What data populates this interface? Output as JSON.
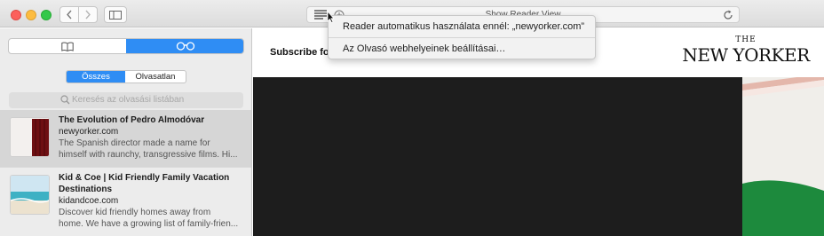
{
  "toolbar": {
    "address_text": "Show Reader View",
    "icons": [
      "back-icon",
      "forward-icon",
      "sidebar-icon",
      "reader-icon",
      "add-icon",
      "reload-icon"
    ]
  },
  "menu": {
    "items": [
      {
        "label": "Reader automatikus használata ennél: „newyorker.com”"
      },
      {
        "label": "Az Olvasó webhelyeinek beállításai…"
      }
    ]
  },
  "sidebar": {
    "filters": {
      "all": "Összes",
      "unread": "Olvasatlan"
    },
    "search": {
      "placeholder": "Keresés az olvasási listában"
    },
    "items": [
      {
        "title": "The Evolution of Pedro Almodóvar",
        "domain": "newyorker.com",
        "desc_line1": "The Spanish director made a name for",
        "desc_line2": "himself with raunchy, transgressive films. Hi..."
      },
      {
        "title_line1": "Kid & Coe | Kid Friendly Family Vacation",
        "title_line2": "Destinations",
        "domain": "kidandcoe.com",
        "desc_line1": "Discover kid friendly homes away from",
        "desc_line2": "home. We have a growing list of family-frien..."
      }
    ]
  },
  "page": {
    "subscribe": "Subscribe fo",
    "logo_the": "THE",
    "logo_main": "NEW YORKER"
  },
  "colors": {
    "accent": "#2f8df4",
    "hero": "#1d1d1d"
  }
}
